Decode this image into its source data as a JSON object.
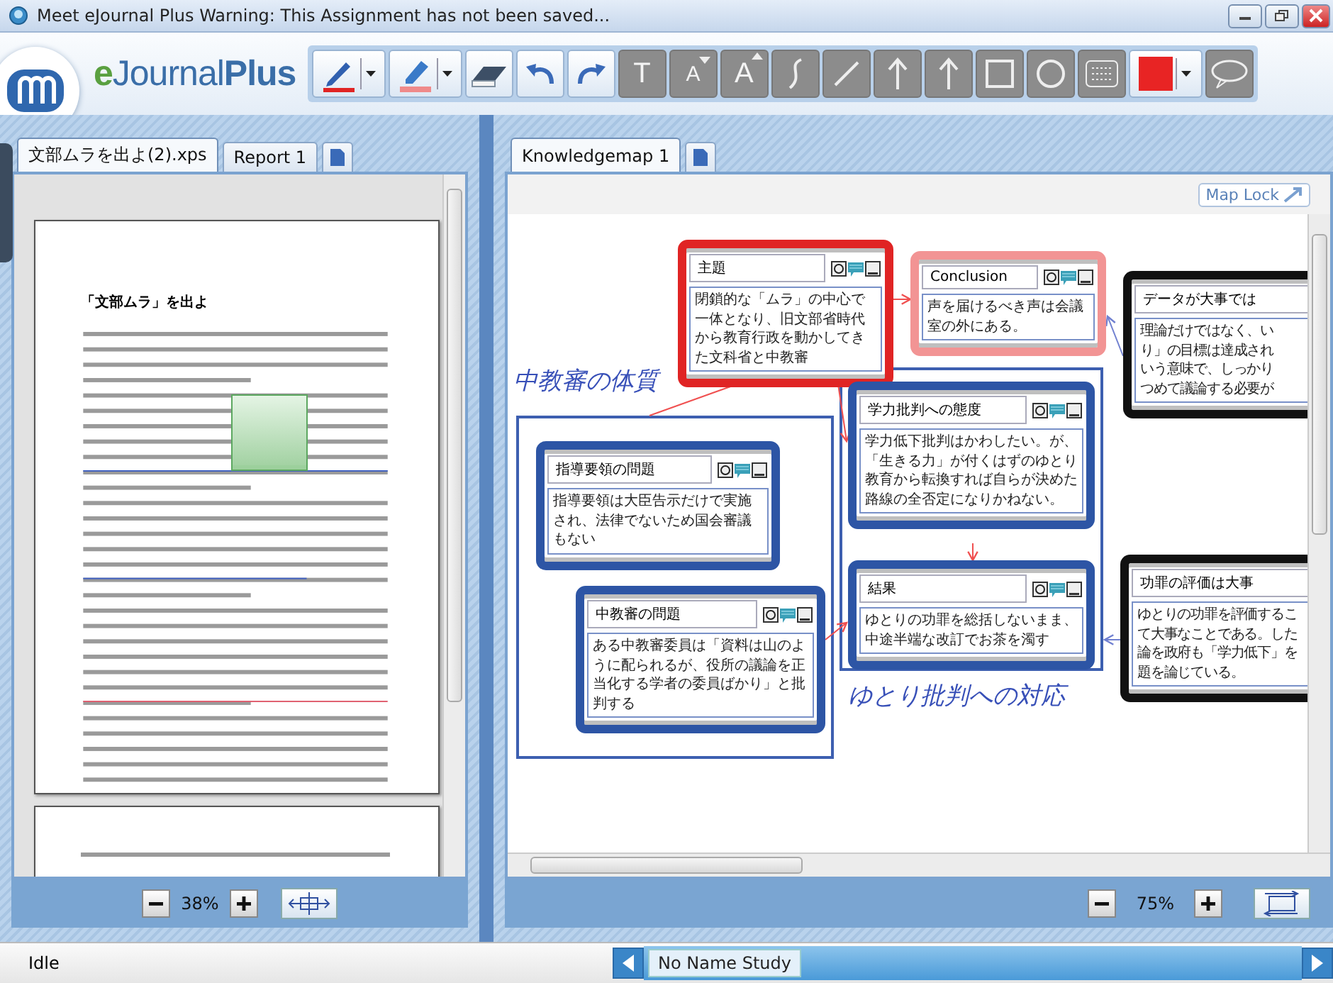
{
  "window": {
    "title": "Meet eJournal Plus Warning: This Assignment has not been saved..."
  },
  "brand": [
    "e",
    "Journal",
    "Plus"
  ],
  "tools": [
    {
      "kind": "pen",
      "disabled": false,
      "dropdown": true
    },
    {
      "kind": "highlighter",
      "disabled": false,
      "dropdown": true
    },
    {
      "kind": "eraser",
      "disabled": false,
      "dropdown": false
    },
    {
      "kind": "undo",
      "disabled": false,
      "dropdown": false
    },
    {
      "kind": "redo",
      "disabled": false,
      "dropdown": false
    },
    {
      "kind": "text",
      "label": "T",
      "disabled": true,
      "dropdown": false
    },
    {
      "kind": "font-smaller",
      "label": "A",
      "disabled": true,
      "dropdown": false
    },
    {
      "kind": "font-larger",
      "label": "A",
      "disabled": true,
      "dropdown": false
    },
    {
      "kind": "curve",
      "disabled": true,
      "dropdown": false
    },
    {
      "kind": "line",
      "disabled": true,
      "dropdown": false
    },
    {
      "kind": "arrow",
      "disabled": true,
      "dropdown": false
    },
    {
      "kind": "arrow",
      "disabled": true,
      "dropdown": false
    },
    {
      "kind": "rectangle",
      "disabled": true,
      "dropdown": false
    },
    {
      "kind": "circle",
      "disabled": true,
      "dropdown": false
    },
    {
      "kind": "grid",
      "disabled": true,
      "dropdown": false
    },
    {
      "kind": "color",
      "color": "#e82424",
      "disabled": false,
      "dropdown": true
    },
    {
      "kind": "bubble",
      "disabled": true,
      "dropdown": false
    }
  ],
  "left_panel": {
    "tabs": [
      {
        "label": "文部ムラを出よ(2).xps",
        "selected": true
      },
      {
        "label": "Report 1",
        "selected": false
      }
    ],
    "document": {
      "title": "「文部ムラ」を出よ"
    },
    "zoom": "38%"
  },
  "right_panel": {
    "tabs": [
      {
        "label": "Knowledgemap 1",
        "selected": true
      }
    ],
    "map_lock": "Map Lock",
    "groups": [
      {
        "label": "中教審の体質"
      },
      {
        "label": "ゆとり批判への対応"
      }
    ],
    "nodes": [
      {
        "title": "主題",
        "color": "#e02424",
        "body": "閉鎖的な「ムラ」の中心で一体となり、旧文部省時代から教育行政を動かしてきた文科省と中教審"
      },
      {
        "title": "Conclusion",
        "color": "#f29494",
        "body": "声を届けるべき声は会議室の外にある。"
      },
      {
        "title": "データが大事では",
        "color": "#111111",
        "lines": [
          "理論だけではなく、い",
          "り」の目標は達成され",
          "いう意味で、しっかり",
          "つめて議論する必要が"
        ]
      },
      {
        "title": "指導要領の問題",
        "color": "#2d55a5",
        "body": "指導要領は大臣告示だけで実施され、法律でないため国会審議もない"
      },
      {
        "title": "学力批判への態度",
        "color": "#2d55a5",
        "body": "学力低下批判はかわしたい。が、「生きる力」が付くはずのゆとり教育から転換すれば自らが決めた路線の全否定になりかねない。"
      },
      {
        "title": "結果",
        "color": "#2d55a5",
        "body": "ゆとりの功罪を総括しないまま、中途半端な改訂でお茶を濁す"
      },
      {
        "title": "中教審の問題",
        "color": "#2d55a5",
        "body": "ある中教審委員は「資料は山のように配られるが、役所の議論を正当化する学者の委員ばかり」と批判する"
      },
      {
        "title": "功罪の評価は大事",
        "color": "#111111",
        "lines": [
          "ゆとりの功罪を評価するこ",
          "て大事なことである。した",
          "論を政府も「学力低下」を",
          "題を論じている。"
        ]
      }
    ],
    "zoom": "75%"
  },
  "status_bar": {
    "state": "Idle",
    "studies": [
      {
        "label": "No Name Study",
        "selected": true
      }
    ]
  }
}
